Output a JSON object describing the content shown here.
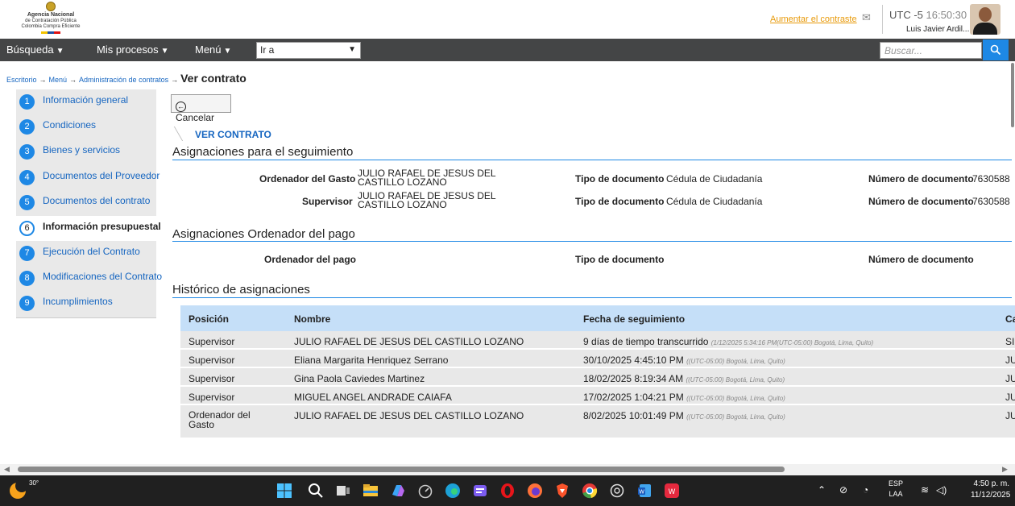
{
  "header": {
    "logo_line1": "Agencia Nacional",
    "logo_line2": "de Contratación Pública",
    "logo_line3": "Colombia Compra Eficiente",
    "contrast_link": "Aumentar el contraste",
    "timezone": "UTC -5",
    "time": "16:50:30",
    "user_name": "Luis Javier Ardil..."
  },
  "nav": {
    "items": [
      {
        "label": "Búsqueda",
        "caret": "▼"
      },
      {
        "label": "Mis procesos",
        "caret": "▼"
      },
      {
        "label": "Menú",
        "caret": "▼"
      }
    ],
    "goto_value": "Ir a",
    "search_placeholder": "Buscar..."
  },
  "breadcrumb": {
    "items": [
      "Escritorio",
      "Menú",
      "Administración de contratos"
    ],
    "separator": "→",
    "current": "Ver contrato"
  },
  "steps": [
    {
      "num": "1",
      "label": "Información general"
    },
    {
      "num": "2",
      "label": "Condiciones"
    },
    {
      "num": "3",
      "label": "Bienes y servicios"
    },
    {
      "num": "4",
      "label": "Documentos del Proveedor"
    },
    {
      "num": "5",
      "label": "Documentos del contrato"
    },
    {
      "num": "6",
      "label": "Información presupuestal",
      "active": true
    },
    {
      "num": "7",
      "label": "Ejecución del Contrato"
    },
    {
      "num": "8",
      "label": "Modificaciones del Contrato"
    },
    {
      "num": "9",
      "label": "Incumplimientos"
    }
  ],
  "main": {
    "cancel_label": "Cancelar",
    "subtitle": "VER CONTRATO",
    "section1": {
      "title": "Asignaciones para el seguimiento",
      "rows": [
        {
          "role_label": "Ordenador del Gasto",
          "name_line1": "JULIO RAFAEL DE JESUS DEL",
          "name_line2": "CASTILLO LOZANO",
          "doc_type_label": "Tipo de documento",
          "doc_type": "Cédula de Ciudadanía",
          "doc_num_label": "Número de documento",
          "doc_num": "7630588"
        },
        {
          "role_label": "Supervisor",
          "name_line1": "JULIO RAFAEL DE JESUS DEL",
          "name_line2": "CASTILLO LOZANO",
          "doc_type_label": "Tipo de documento",
          "doc_type": "Cédula de Ciudadanía",
          "doc_num_label": "Número de documento",
          "doc_num": "7630588"
        }
      ]
    },
    "section2": {
      "title": "Asignaciones Ordenador del pago",
      "role_label": "Ordenador del pago",
      "doc_type_label": "Tipo de documento",
      "doc_num_label": "Número de documento"
    },
    "section3": {
      "title": "Histórico de asignaciones",
      "columns": [
        "Posición",
        "Nombre",
        "Fecha de seguimiento",
        "Ca"
      ],
      "rows": [
        {
          "pos": "Supervisor",
          "pos2": "",
          "name": "JULIO RAFAEL DE JESUS DEL CASTILLO LOZANO",
          "date": "9 días de tiempo transcurrido",
          "tz": "(1/12/2025 5:34:16 PM(UTC-05:00) Bogotá, Lima, Quito)",
          "last": "SI"
        },
        {
          "pos": "Supervisor",
          "pos2": "",
          "name": "Eliana Margarita Henriquez Serrano",
          "date": "30/10/2025 4:45:10 PM",
          "tz": "((UTC-05:00) Bogotá, Lima, Quito)",
          "last": "JU"
        },
        {
          "pos": "Supervisor",
          "pos2": "",
          "name": "Gina Paola Caviedes Martinez",
          "date": "18/02/2025 8:19:34 AM",
          "tz": "((UTC-05:00) Bogotá, Lima, Quito)",
          "last": "JU"
        },
        {
          "pos": "Supervisor",
          "pos2": "",
          "name": "MIGUEL ANGEL ANDRADE CAIAFA",
          "date": "17/02/2025 1:04:21 PM",
          "tz": "((UTC-05:00) Bogotá, Lima, Quito)",
          "last": "JU"
        },
        {
          "pos": "Ordenador del",
          "pos2": "Gasto",
          "name": "JULIO RAFAEL DE JESUS DEL CASTILLO LOZANO",
          "date": "8/02/2025 10:01:49 PM",
          "tz": "((UTC-05:00) Bogotá, Lima, Quito)",
          "last": "JU"
        }
      ]
    }
  },
  "taskbar": {
    "temperature": "30°",
    "lang1": "ESP",
    "lang2": "LAA",
    "time": "4:50 p. m.",
    "date": "11/12/2025"
  },
  "colors": {
    "nav_bg": "#444546",
    "accent_blue": "#1e88e5",
    "link_blue": "#1565c0",
    "contrast_orange": "#e89a0a",
    "table_header": "#c5dff8",
    "table_row": "#e8e8e8"
  }
}
